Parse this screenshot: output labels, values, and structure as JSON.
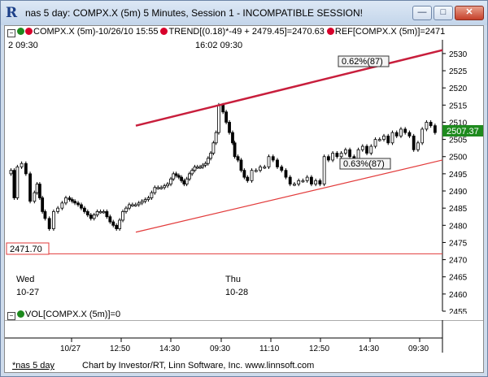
{
  "window": {
    "title": "nas 5 day: COMPX.X (5m) 5 Minutes, Session 1 - INCOMPATIBLE SESSION!",
    "min_label": "—",
    "max_label": "□",
    "close_label": "✕"
  },
  "legend": {
    "buttons": [
      "−",
      "−"
    ],
    "entries": [
      {
        "text": "COMPX.X (5m)-10/26/10 15:55",
        "color": "#1e8a1e"
      },
      {
        "text": "TREND[(0.18)*-49 + 2479.45]=2470.63",
        "color": "#d7002b"
      },
      {
        "text": "REF[COMPX.X (5m)]=2471",
        "color": "#d7002b"
      }
    ]
  },
  "time_top": {
    "t1": "2 09:30",
    "t2": "16:02 09:30"
  },
  "annotations": {
    "upper_pct": "0.62%(87)",
    "lower_pct": "0.63%(87)",
    "ref_value": "2471.70",
    "last_price": "2507.37"
  },
  "day_labels": [
    {
      "day": "Wed",
      "date": "10-27"
    },
    {
      "day": "Thu",
      "date": "10-28"
    }
  ],
  "volume_legend": "VOL[COMPX.X (5m)]=0",
  "chart_data": {
    "type": "candlestick",
    "symbol": "COMPX.X (5m)",
    "ylim": [
      2455,
      2534
    ],
    "yticks": [
      2455,
      2460,
      2465,
      2470,
      2475,
      2480,
      2485,
      2490,
      2495,
      2500,
      2505,
      2510,
      2515,
      2520,
      2525,
      2530
    ],
    "xticks": [
      "10/27",
      "12:50",
      "14:30",
      "09:30",
      "11:10",
      "12:50",
      "14:30",
      "09:30"
    ],
    "close_path": [
      [
        0,
        2495
      ],
      [
        3,
        2496
      ],
      [
        6,
        2488
      ],
      [
        10,
        2497
      ],
      [
        14,
        2498
      ],
      [
        18,
        2495
      ],
      [
        22,
        2487
      ],
      [
        27,
        2492
      ],
      [
        32,
        2484
      ],
      [
        36,
        2482
      ],
      [
        40,
        2479
      ],
      [
        44,
        2484
      ],
      [
        48,
        2485
      ],
      [
        55,
        2488
      ],
      [
        60,
        2487
      ],
      [
        66,
        2486
      ],
      [
        72,
        2484
      ],
      [
        78,
        2482
      ],
      [
        84,
        2484
      ],
      [
        90,
        2484
      ],
      [
        96,
        2481
      ],
      [
        102,
        2479
      ],
      [
        108,
        2484
      ],
      [
        114,
        2486
      ],
      [
        120,
        2486
      ],
      [
        126,
        2487
      ],
      [
        132,
        2488
      ],
      [
        138,
        2491
      ],
      [
        144,
        2491
      ],
      [
        150,
        2492
      ],
      [
        155,
        2495
      ],
      [
        160,
        2494
      ],
      [
        165,
        2492
      ],
      [
        170,
        2495
      ],
      [
        175,
        2497
      ],
      [
        180,
        2497
      ],
      [
        185,
        2498
      ],
      [
        190,
        2501
      ],
      [
        195,
        2507
      ],
      [
        199,
        2515
      ],
      [
        202,
        2513
      ],
      [
        205,
        2510
      ],
      [
        208,
        2507
      ],
      [
        210,
        2504
      ],
      [
        213,
        2500
      ],
      [
        216,
        2499
      ],
      [
        219,
        2496
      ],
      [
        222,
        2494
      ],
      [
        226,
        2493
      ],
      [
        230,
        2496
      ],
      [
        234,
        2496
      ],
      [
        238,
        2497
      ],
      [
        242,
        2497
      ],
      [
        246,
        2500
      ],
      [
        250,
        2499
      ],
      [
        254,
        2497
      ],
      [
        258,
        2496
      ],
      [
        262,
        2494
      ],
      [
        266,
        2492
      ],
      [
        270,
        2492
      ],
      [
        274,
        2493
      ],
      [
        278,
        2493
      ],
      [
        282,
        2494
      ],
      [
        286,
        2492
      ],
      [
        290,
        2493
      ],
      [
        294,
        2492
      ],
      [
        298,
        2500
      ],
      [
        302,
        2499
      ],
      [
        306,
        2501
      ],
      [
        310,
        2500
      ],
      [
        314,
        2501
      ],
      [
        318,
        2502
      ],
      [
        322,
        2500
      ],
      [
        326,
        2499
      ],
      [
        330,
        2502
      ],
      [
        334,
        2503
      ],
      [
        338,
        2501
      ],
      [
        342,
        2503
      ],
      [
        346,
        2505
      ],
      [
        350,
        2505
      ],
      [
        354,
        2506
      ],
      [
        358,
        2504
      ],
      [
        362,
        2507
      ],
      [
        366,
        2506
      ],
      [
        370,
        2508
      ],
      [
        374,
        2507
      ],
      [
        378,
        2506
      ],
      [
        382,
        2502
      ],
      [
        386,
        2504
      ],
      [
        390,
        2508
      ],
      [
        394,
        2510
      ],
      [
        398,
        2509
      ],
      [
        402,
        2507
      ]
    ],
    "trend_upper": {
      "from": [
        161,
        2509
      ],
      "to": [
        430,
        2529
      ]
    },
    "trend_lower": {
      "from": [
        161,
        2478
      ],
      "to": [
        430,
        2499
      ]
    },
    "ref_line": 2471.7
  },
  "colors": {
    "trend_upper": "#c81e3c",
    "trend_lower": "#e23b3b",
    "ref": "#e23b3b",
    "up_candle": "#ffffff",
    "down_candle": "#000000",
    "last_price_bg": "#1e8a1e"
  },
  "status": {
    "tab": "*nas 5 day",
    "credit": "Chart by Investor/RT, Linn Software, Inc. www.linnsoft.com"
  }
}
